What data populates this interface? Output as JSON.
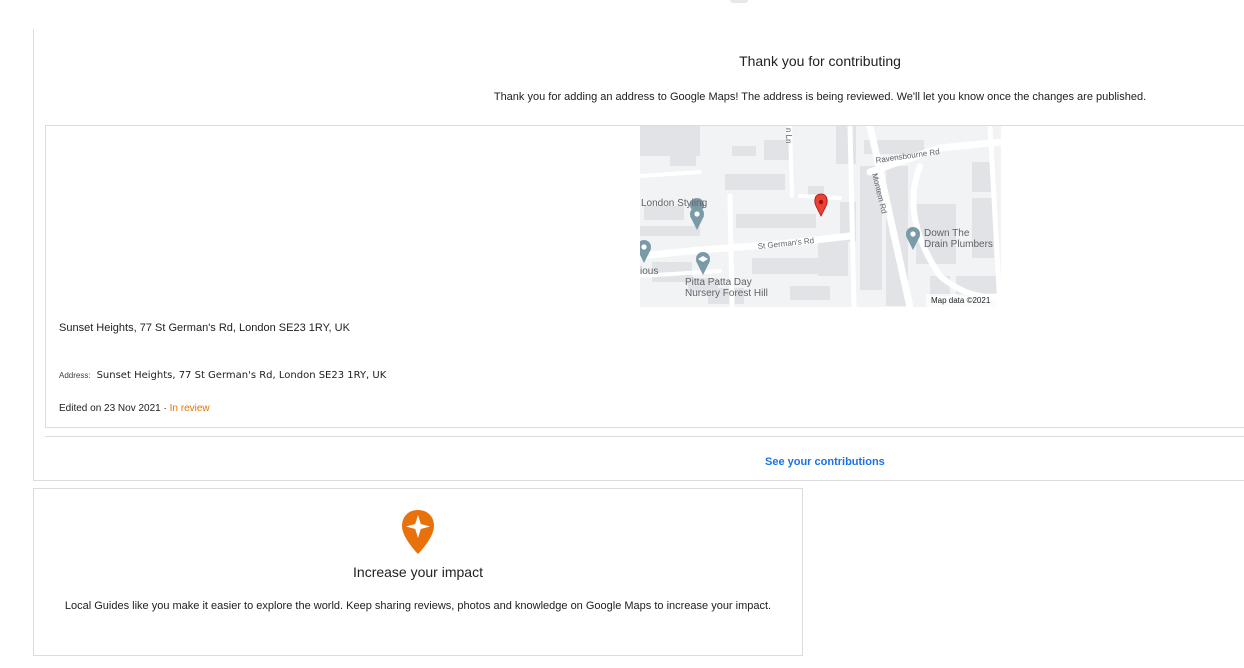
{
  "confirmation": {
    "title": "Thank you for contributing",
    "message": "Thank you for adding an address to Google Maps! The address is being reviewed. We'll let you know once the changes are published."
  },
  "place": {
    "name": "Sunset Heights, 77 St German's Rd, London SE23 1RY, UK",
    "address_label": "Address:",
    "address_value": "Sunset Heights, 77 St German's Rd, London SE23 1RY, UK",
    "edited_text": "Edited on 23 Nov 2021 · ",
    "status": "In review"
  },
  "map": {
    "labels": {
      "ravensbourne": "Ravensbourne Rd",
      "montem": "Montem Rd",
      "st_germans": "St German's Rd",
      "london_styling": "London Styling",
      "down_the_1": "Down The",
      "down_the_2": "Drain Plumbers",
      "pitta_1": "Pitta Patta Day",
      "pitta_2": "Nursery Forest Hill",
      "ious": "ious",
      "ln": "n Ln",
      "attribution": "Map data ©2021"
    },
    "pin_color": "#ea4335"
  },
  "links": {
    "see_contributions": "See your contributions"
  },
  "impact": {
    "title": "Increase your impact",
    "message": "Local Guides like you make it easier to explore the world. Keep sharing reviews, photos and knowledge on Google Maps to increase your impact.",
    "icon_color": "#e8710a"
  }
}
